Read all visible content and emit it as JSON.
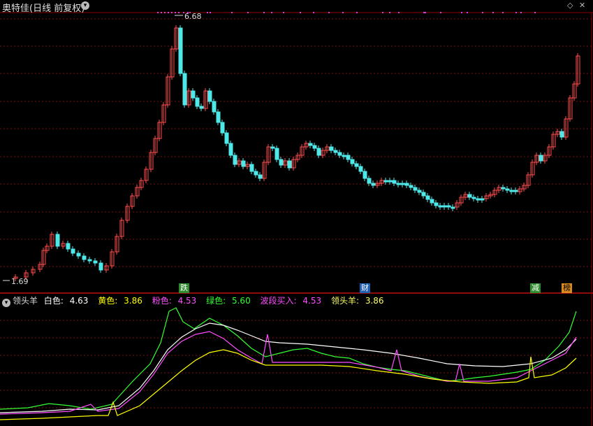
{
  "window": {
    "title": "奥特佳(日线 前复权)"
  },
  "main_chart": {
    "high_label": "6.68",
    "low_label": "1.69",
    "markers": [
      {
        "text": "跌",
        "bg": "#2e8b2e",
        "color": "#ffffff"
      },
      {
        "text": "财",
        "bg": "#1e5fb0",
        "color": "#ffffff"
      },
      {
        "text": "减",
        "bg": "#2e8b2e",
        "color": "#ffffff"
      },
      {
        "text": "榜",
        "bg": "#d98a1f",
        "color": "#000000"
      }
    ]
  },
  "indicator": {
    "name": "领头羊",
    "items": [
      {
        "label": "白色:",
        "value": "4.63",
        "color": "#ffffff"
      },
      {
        "label": "黄色:",
        "value": "3.86",
        "color": "#ffff00"
      },
      {
        "label": "粉色:",
        "value": "4.53",
        "color": "#ff4dff"
      },
      {
        "label": "绿色:",
        "value": "5.60",
        "color": "#33ff33"
      },
      {
        "label": "波段买入:",
        "value": "4.53",
        "color": "#ff4dff"
      },
      {
        "label": "领头羊:",
        "value": "3.86",
        "color": "#ffff66"
      }
    ]
  },
  "colors": {
    "up": "#ff4d4d",
    "down": "#4ee8e8",
    "grid": "#7a1010",
    "divider": "#8b0000"
  },
  "icons": {
    "dropdown": "chevron-down-icon",
    "diamond": "diamond-icon",
    "close": "close-icon"
  }
}
